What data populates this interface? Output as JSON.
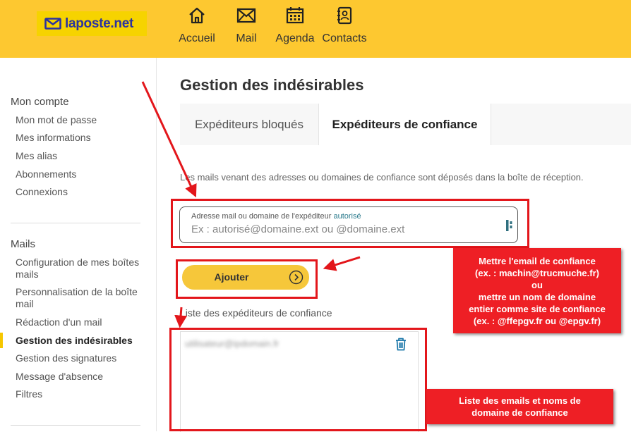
{
  "header": {
    "logo_text": "laposte.net",
    "nav": [
      {
        "label": "Accueil",
        "icon": "home-icon"
      },
      {
        "label": "Mail",
        "icon": "mail-icon"
      },
      {
        "label": "Agenda",
        "icon": "calendar-icon"
      },
      {
        "label": "Contacts",
        "icon": "contacts-icon"
      }
    ]
  },
  "sidebar": {
    "section1_title": "Mon compte",
    "section1_items": [
      "Mon mot de passe",
      "Mes informations",
      "Mes alias",
      "Abonnements",
      "Connexions"
    ],
    "section2_title": "Mails",
    "section2_items": [
      "Configuration de mes boîtes mails",
      "Personnalisation de la boîte mail",
      "Rédaction d'un mail",
      "Gestion des indésirables",
      "Gestion des signatures",
      "Message d'absence",
      "Filtres"
    ],
    "active_item": "Gestion des indésirables"
  },
  "main": {
    "title": "Gestion des indésirables",
    "tabs": [
      {
        "label": "Expéditeurs bloqués",
        "active": false
      },
      {
        "label": "Expéditeurs de confiance",
        "active": true
      }
    ],
    "description": "Les mails venant des adresses ou domaines de confiance sont déposés dans la boîte de réception.",
    "input": {
      "label": "Adresse mail ou domaine de l'expéditeur",
      "label_accent": "autorisé",
      "placeholder": "Ex : autorisé@domaine.ext ou @domaine.ext",
      "value": ""
    },
    "add_button_label": "Ajouter",
    "list_title": "Liste des expéditeurs de confiance",
    "list_items": [
      "utilisateur@ipdomain.fr"
    ]
  },
  "annotations": {
    "note1_lines": [
      "Mettre l'email de confiance",
      "(ex. : machin@trucmuche.fr)",
      "ou",
      "mettre un nom de domaine",
      "entier comme site de confiance",
      "(ex. : @ffepgv.fr ou @epgv.fr)"
    ],
    "note2_lines": [
      "Liste des emails et noms de",
      "domaine de confiance"
    ]
  },
  "colors": {
    "header_bg": "#fdc830",
    "logo_bg": "#f6d300",
    "logo_text": "#2b33a0",
    "button_bg": "#f6c73a",
    "annotation_red": "#e3161b",
    "active_marker": "#f6c700"
  }
}
